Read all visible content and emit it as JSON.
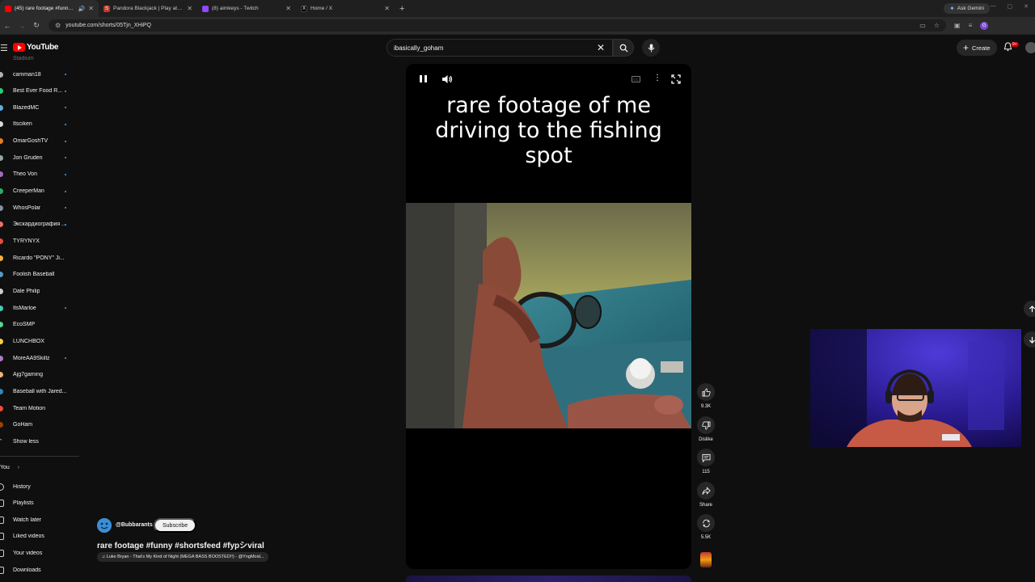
{
  "browser": {
    "tabs": [
      {
        "title": "(45) rare footage #funny #s",
        "active": true,
        "fav_color": "#ff0000",
        "audio": true
      },
      {
        "title": "Pandora Blackjack | Play at Bo",
        "active": false,
        "fav_color": "#c0392b",
        "fav_glyph": "S"
      },
      {
        "title": "(8) aimkeys - Twitch",
        "active": false,
        "fav_color": "#9146ff"
      },
      {
        "title": "Home / X",
        "active": false,
        "fav_color": "#000000",
        "fav_glyph": "X"
      }
    ],
    "ask_gemini": "Ask Gemini",
    "url": "youtube.com/shorts/05Tjn_XHiPQ"
  },
  "youtube": {
    "logo_text": "YouTube",
    "search_value": "ibasically_goham",
    "create_label": "Create",
    "notif_badge": "9+"
  },
  "sidebar": {
    "top_partial": "Stadium",
    "subscriptions": [
      {
        "label": "camman18",
        "live": true,
        "color": "#b0b0b0"
      },
      {
        "label": "Best Ever Food R...",
        "live": true,
        "color": "#2ecc71"
      },
      {
        "label": "BlazedMC",
        "live": true,
        "color": "#5dade2"
      },
      {
        "label": "Itsciken",
        "live": true,
        "color": "#d5d8dc"
      },
      {
        "label": "OmarGoshTV",
        "live": true,
        "color": "#e67e22"
      },
      {
        "label": "Jon Gruden",
        "live": true,
        "color": "#95a5a6"
      },
      {
        "label": "Theo Von",
        "live": true,
        "color": "#a569bd"
      },
      {
        "label": "CreeperMan",
        "live": true,
        "color": "#27ae60"
      },
      {
        "label": "WhosPolar",
        "live": true,
        "color": "#85929e"
      },
      {
        "label": "Экскардиография ...",
        "live": true,
        "color": "#ec7063"
      },
      {
        "label": "TYRYNYX",
        "live": false,
        "color": "#e74c3c"
      },
      {
        "label": "Ricardo \"PONY\" Ji...",
        "live": false,
        "color": "#f5b041"
      },
      {
        "label": "Foolish Baseball",
        "live": false,
        "color": "#5499c7"
      },
      {
        "label": "Dale Philip",
        "live": false,
        "color": "#cacfd2"
      },
      {
        "label": "ItsMarloe",
        "live": true,
        "color": "#48c9b0"
      },
      {
        "label": "EcoSMP",
        "live": false,
        "color": "#58d68d"
      },
      {
        "label": "LUNCHBOX",
        "live": false,
        "color": "#f4d03f"
      },
      {
        "label": "MoreAA9Skillz",
        "live": true,
        "color": "#af7ac5"
      },
      {
        "label": "Ajg7gaming",
        "live": false,
        "color": "#f0b27a"
      },
      {
        "label": "Baseball with Jared...",
        "live": false,
        "color": "#2e86c1"
      },
      {
        "label": "Team Motion",
        "live": false,
        "color": "#e74c3c"
      },
      {
        "label": "GoHam",
        "live": false,
        "color": "#a04000"
      },
      {
        "label": "Show less",
        "live": false,
        "color": ""
      }
    ],
    "you_label": "You",
    "you_items": [
      "History",
      "Playlists",
      "Watch later",
      "Liked videos",
      "Your videos",
      "Downloads"
    ]
  },
  "short": {
    "caption_lines": [
      "rare footage of me",
      "driving to the fishing",
      "spot"
    ],
    "channel": "@Bubbarants",
    "subscribe_label": "Subscribe",
    "title": "rare footage #funny #shortsfeed #fypシviral",
    "music": "♫ Luke Bryan - That's My Kind of Night (MEGA BASS BOOSTED!!) - @YngMoid...",
    "cc_label": "CC"
  },
  "actions": {
    "likes": "9.3K",
    "dislike_label": "Dislike",
    "comments": "115",
    "share_label": "Share",
    "remix": "5.5K"
  },
  "colors": {
    "bg": "#0f0f0f",
    "accent_red": "#ff0000",
    "live_dot": "#3ea6ff"
  }
}
